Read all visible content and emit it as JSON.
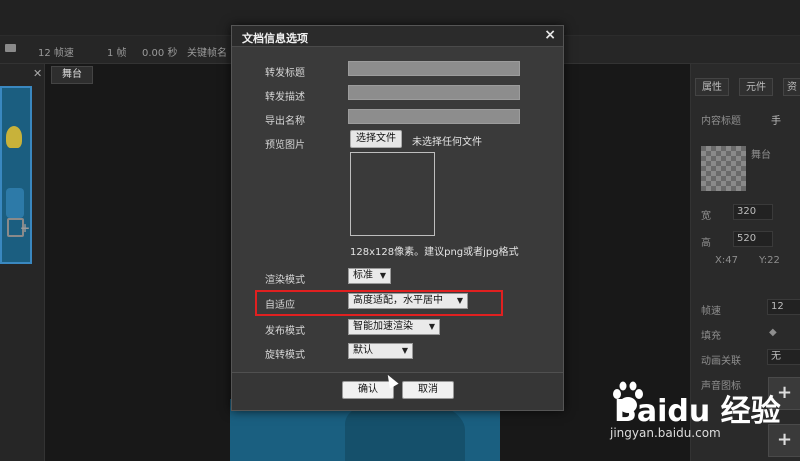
{
  "timeline": {
    "fps": "12 帧速",
    "frame": "1 帧",
    "time": "0.00 秒",
    "keyframe": "关键帧名"
  },
  "stage": {
    "tab_label": "舞台"
  },
  "right_panel": {
    "tabs": [
      "属性",
      "元件",
      "资"
    ],
    "content_title_label": "内容标题",
    "content_title_value": "手",
    "stage_label": "舞台",
    "width_label": "宽",
    "width_value": "320",
    "height_label": "高",
    "height_value": "520",
    "x_label": "X:47",
    "y_label": "Y:22",
    "fps_label": "帧速",
    "fps_value": "12",
    "fill_label": "填充",
    "anim_label": "动画关联",
    "anim_value": "无",
    "sound_label": "声音图标"
  },
  "dialog": {
    "title": "文档信息选项",
    "close": "×",
    "fields": {
      "share_title": "转发标题",
      "share_desc": "转发描述",
      "export_name": "导出名称",
      "preview": "预览图片"
    },
    "file_button": "选择文件",
    "file_status": "未选择任何文件",
    "hint": "128x128像素。建议png或者jpg格式",
    "render_mode": {
      "label": "渲染模式",
      "value": "标准"
    },
    "adaptive": {
      "label": "自适应",
      "value": "高度适配，水平居中"
    },
    "publish_mode": {
      "label": "发布模式",
      "value": "智能加速渲染"
    },
    "rotate_mode": {
      "label": "旋转模式",
      "value": "默认"
    },
    "ok": "确认",
    "cancel": "取消"
  },
  "watermark": {
    "brand": "Baidu 经验",
    "url": "jingyan.baidu.com"
  },
  "colors": {
    "highlight": "#e02020",
    "dialog_bg": "#3a3a3a"
  }
}
